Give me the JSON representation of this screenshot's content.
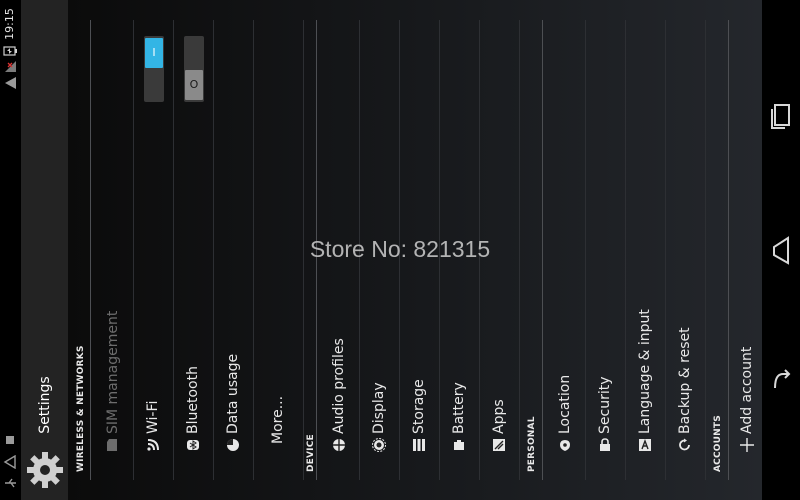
{
  "status_bar": {
    "time": "19:15",
    "icons": [
      "battery-charging-icon",
      "signal-icon",
      "wifi-icon",
      "usb-icon",
      "warning-icon",
      "notification-icon"
    ]
  },
  "action_bar": {
    "title": "Settings",
    "icon": "gear-icon"
  },
  "sections": {
    "wireless": "WIRELESS & NETWORKS",
    "device": "DEVICE",
    "personal": "PERSONAL",
    "accounts": "ACCOUNTS"
  },
  "items": {
    "sim": {
      "label": "SIM management",
      "icon": "sim-card-icon"
    },
    "wifi": {
      "label": "Wi-Fi",
      "icon": "wifi-icon",
      "toggle": "I"
    },
    "bluetooth": {
      "label": "Bluetooth",
      "icon": "bluetooth-icon",
      "toggle": "O"
    },
    "data_usage": {
      "label": "Data usage",
      "icon": "data-usage-icon"
    },
    "more": {
      "label": "More..."
    },
    "audio": {
      "label": "Audio profiles",
      "icon": "audio-profiles-icon"
    },
    "display": {
      "label": "Display",
      "icon": "display-icon"
    },
    "storage": {
      "label": "Storage",
      "icon": "storage-icon"
    },
    "battery": {
      "label": "Battery",
      "icon": "battery-icon"
    },
    "apps": {
      "label": "Apps",
      "icon": "apps-icon"
    },
    "location": {
      "label": "Location",
      "icon": "location-icon"
    },
    "security": {
      "label": "Security",
      "icon": "lock-icon"
    },
    "language": {
      "label": "Language & input",
      "icon": "language-icon"
    },
    "backup": {
      "label": "Backup & reset",
      "icon": "backup-icon"
    },
    "add_account": {
      "label": "Add account",
      "icon": "plus-icon"
    }
  },
  "watermark": "Store No: 821315",
  "nav_bar": {
    "buttons": [
      "recent-apps-icon",
      "home-icon",
      "back-icon"
    ]
  },
  "colors": {
    "accent": "#33b5e5",
    "background": "#1a1c1f",
    "action_bar": "#232323"
  }
}
